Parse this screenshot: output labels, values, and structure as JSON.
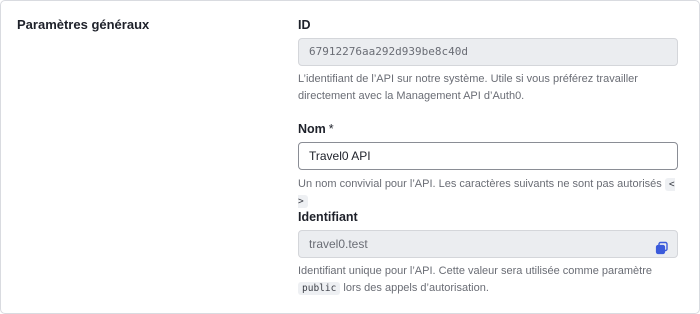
{
  "section": {
    "title": "Paramètres généraux"
  },
  "id_field": {
    "label": "ID",
    "value": "67912276aa292d939be8c40d",
    "help": "L’identifiant de l’API sur notre système. Utile si vous préférez travailler directement avec la Management API d’Auth0."
  },
  "name_field": {
    "label": "Nom",
    "required_mark": "*",
    "value": "Travel0 API",
    "help": "Un nom convivial pour l’API. Les caractères suivants ne sont pas autorisés",
    "code": "< >"
  },
  "identifier_field": {
    "label": "Identifiant",
    "value": "travel0.test",
    "copy_icon": "copy-icon",
    "help_before": "Identifiant unique pour l’API. Cette valeur sera utilisée comme paramètre",
    "code": "public",
    "help_after": " lors des appels d’autorisation."
  },
  "colors": {
    "accent": "#3b5bdb",
    "border": "#d9dbe0"
  }
}
